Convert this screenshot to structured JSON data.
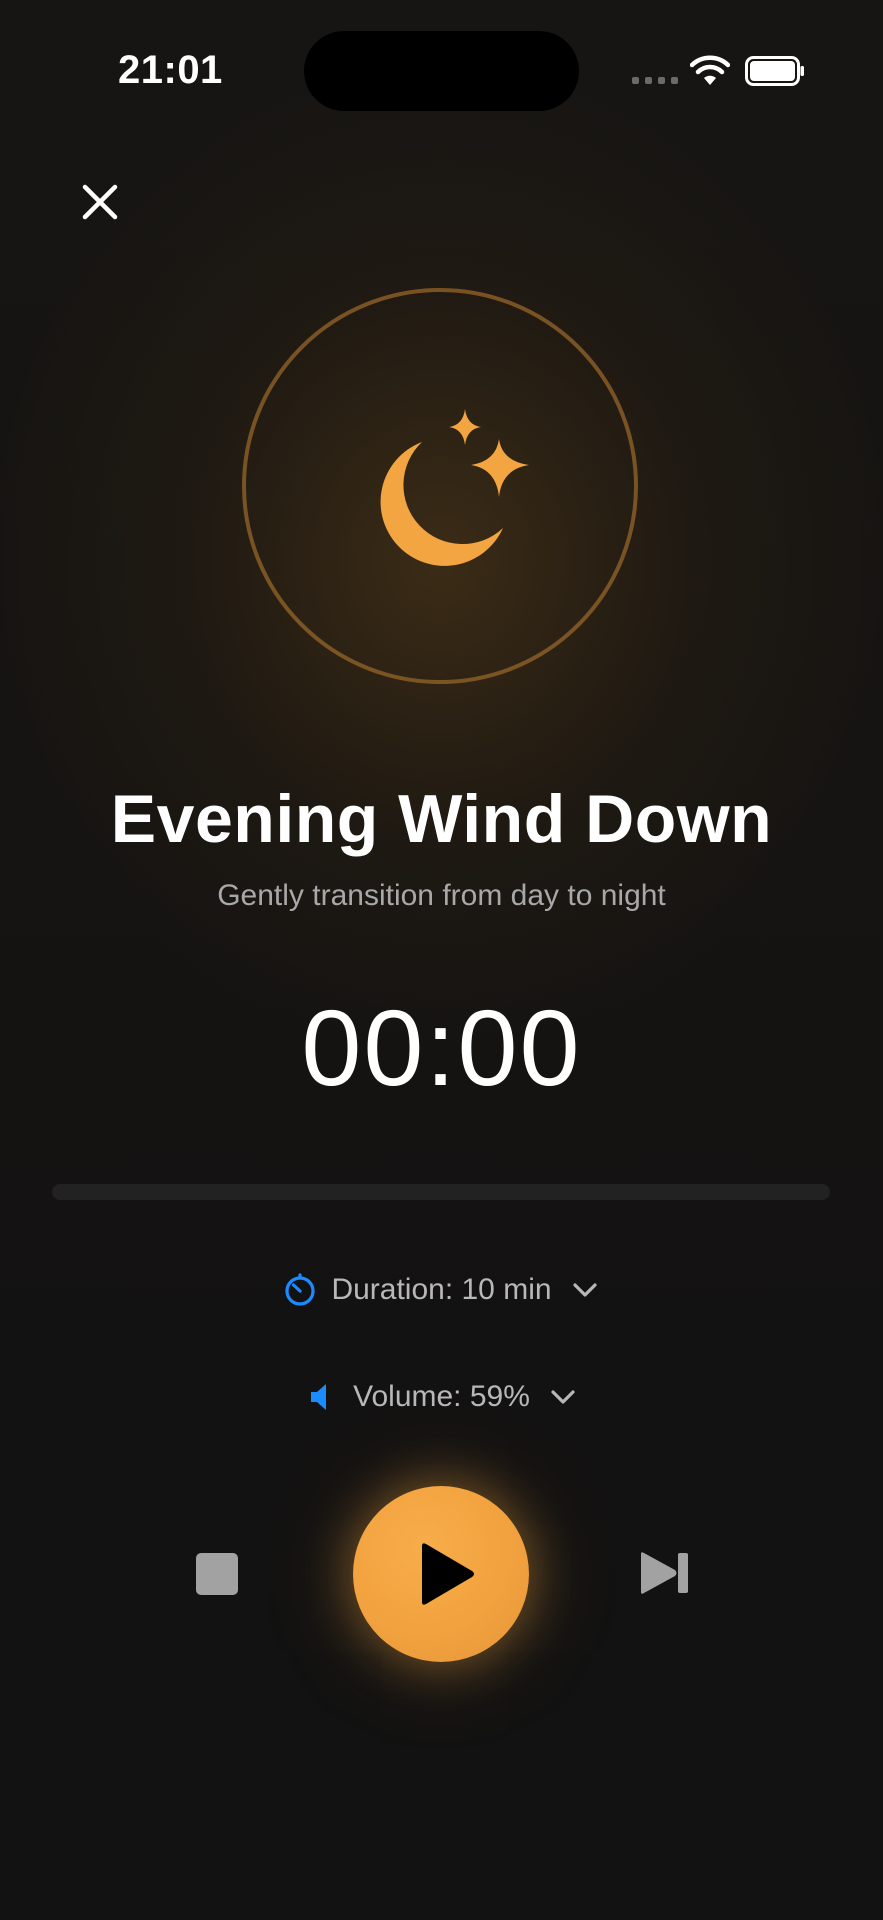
{
  "status_bar": {
    "time": "21:01"
  },
  "header": {
    "close_icon": "close-icon"
  },
  "artwork": {
    "icon": "moon-stars-icon",
    "accent_color": "#F2A540",
    "ring_color": "#8E6128"
  },
  "session": {
    "title": "Evening Wind Down",
    "subtitle": "Gently transition from day to night",
    "timer": "00:00",
    "progress": 0
  },
  "options": {
    "duration_label": "Duration: 10 min",
    "duration_icon": "timer-icon",
    "volume_label": "Volume: 59%",
    "volume_icon": "speaker-icon",
    "icon_color": "#1A8CFF"
  },
  "controls": {
    "stop_icon": "stop-icon",
    "play_icon": "play-icon",
    "skip_icon": "skip-forward-icon",
    "play_color": "#F2A540"
  }
}
